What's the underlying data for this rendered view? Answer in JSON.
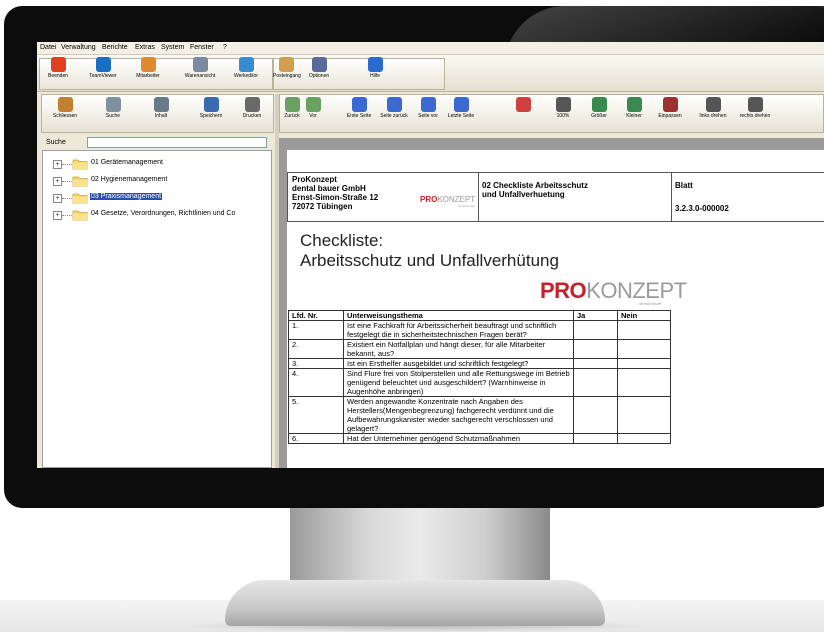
{
  "menu": [
    "Datei",
    "Verwaltung",
    "Berichte",
    "Extras",
    "System",
    "Fenster",
    "?"
  ],
  "toolbar": {
    "buttons": [
      {
        "label": "Beenden",
        "icon": "power-icon",
        "color": "#e04020"
      },
      {
        "label": "TeamViewer",
        "icon": "teamviewer-icon",
        "color": "#1a6fc0"
      },
      {
        "label": "Mitarbeiter",
        "icon": "users-icon",
        "color": "#e08a30"
      },
      {
        "label": "Warenansicht",
        "icon": "catalog-icon",
        "color": "#7a8aa0"
      },
      {
        "label": "Werkeditor",
        "icon": "editor-icon",
        "color": "#3a8ad0"
      },
      {
        "label": "Posteingang",
        "icon": "inbox-icon",
        "color": "#d0a050"
      },
      {
        "label": "Optionen",
        "icon": "options-icon",
        "color": "#5a6a9a"
      },
      {
        "label": "Hilfe",
        "icon": "help-icon",
        "color": "#2a6ad0"
      }
    ]
  },
  "left_toolbar": [
    {
      "label": "Schliessen",
      "icon": "close-doc-icon",
      "color": "#c08030"
    },
    {
      "label": "Suche",
      "icon": "search-icon",
      "color": "#8090a0"
    },
    {
      "label": "Inhalt",
      "icon": "contents-icon",
      "color": "#6a7a8a"
    },
    {
      "label": "Speichern",
      "icon": "save-icon",
      "color": "#3a6ab0"
    },
    {
      "label": "Drucken",
      "icon": "print-icon",
      "color": "#6a6a6a"
    }
  ],
  "search": {
    "label": "Suche",
    "value": ""
  },
  "tree": [
    {
      "label": "01 Gerätemanagement",
      "selected": false
    },
    {
      "label": "02 Hygienemanagement",
      "selected": false
    },
    {
      "label": "03 Praxismanagement",
      "selected": true
    },
    {
      "label": "04 Gesetze, Verordnungen, Richtlinien und Co",
      "selected": false
    }
  ],
  "viewer_toolbar": [
    {
      "label": "Zurück",
      "icon": "back-icon",
      "color": "#6aa060"
    },
    {
      "label": "Vor",
      "icon": "forward-icon",
      "color": "#6aa060"
    },
    {
      "label": "Erste Seite",
      "icon": "first-page-icon",
      "color": "#3a6ad0"
    },
    {
      "label": "Seite zurück",
      "icon": "prev-page-icon",
      "color": "#3a6ad0"
    },
    {
      "label": "Seite vor",
      "icon": "next-page-icon",
      "color": "#3a6ad0"
    },
    {
      "label": "Letzte Seite",
      "icon": "last-page-icon",
      "color": "#3a6ad0"
    },
    {
      "label": "",
      "icon": "highlight-icon",
      "color": "#d04040"
    },
    {
      "label": "100%",
      "icon": "zoom-100-icon",
      "color": "#555555"
    },
    {
      "label": "Größer",
      "icon": "zoom-in-icon",
      "color": "#3a8a50"
    },
    {
      "label": "Kleiner",
      "icon": "zoom-out-icon",
      "color": "#3a8a50"
    },
    {
      "label": "Einpassen",
      "icon": "fit-icon",
      "color": "#a03030"
    },
    {
      "label": "links drehen",
      "icon": "rotate-left-icon",
      "color": "#555555"
    },
    {
      "label": "rechts drehen",
      "icon": "rotate-right-icon",
      "color": "#555555"
    }
  ],
  "document": {
    "company": [
      "ProKonzept",
      "dental bauer GmbH",
      "Ernst-Simon-Straße 12",
      "72072 Tübingen"
    ],
    "logo_small": {
      "pro": "PRO",
      "konzept": "KONZEPT",
      "sub": "dental bauer"
    },
    "doc_name": [
      "02 Checkliste Arbeitsschutz",
      "und Unfallverhuetung"
    ],
    "blatt_label": "Blatt",
    "blatt_value": "3.2.3.0-000002",
    "title_line1": "Checkliste:",
    "title_line2": "Arbeitsschutz und Unfallverhütung",
    "logo_big": {
      "pro": "PRO",
      "konzept": "KONZEPT",
      "sub": "dental bauer"
    },
    "table_headers": [
      "Lfd. Nr.",
      "Unterweisungsthema",
      "Ja",
      "Nein"
    ],
    "rows": [
      {
        "nr": "1.",
        "text": "Ist eine Fachkraft für Arbeitssicherheit beauftragt und schriftlich festgelegt die in sicherheitstechnischen Fragen berät?"
      },
      {
        "nr": "2.",
        "text": "Existiert ein Notfallplan und hängt dieser, für alle Mitarbeiter bekannt, aus?"
      },
      {
        "nr": "3.",
        "text": "Ist ein Ersthelfer ausgebildet und schriftlich festgelegt?"
      },
      {
        "nr": "4.",
        "text": "Sind Flure frei von Stolperstellen und alle Rettungswege im Betrieb genügend beleuchtet und ausgeschildert? (Warnhinweise in Augenhöhe anbringen)"
      },
      {
        "nr": "5.",
        "text": "Werden angewandte Konzentrate nach Angaben des Herstellers(Mengenbegrenzung) fachgerecht verdünnt und die Aufbewahrungskanister wieder sachgerecht verschlossen und gelagert?"
      },
      {
        "nr": "6.",
        "text": "Hat der Unternehmer genügend Schutzmaßnahmen"
      }
    ]
  },
  "colors": {
    "accent_red": "#c8202a",
    "selection": "#2b4fa8",
    "window_bg": "#ece9d8"
  }
}
